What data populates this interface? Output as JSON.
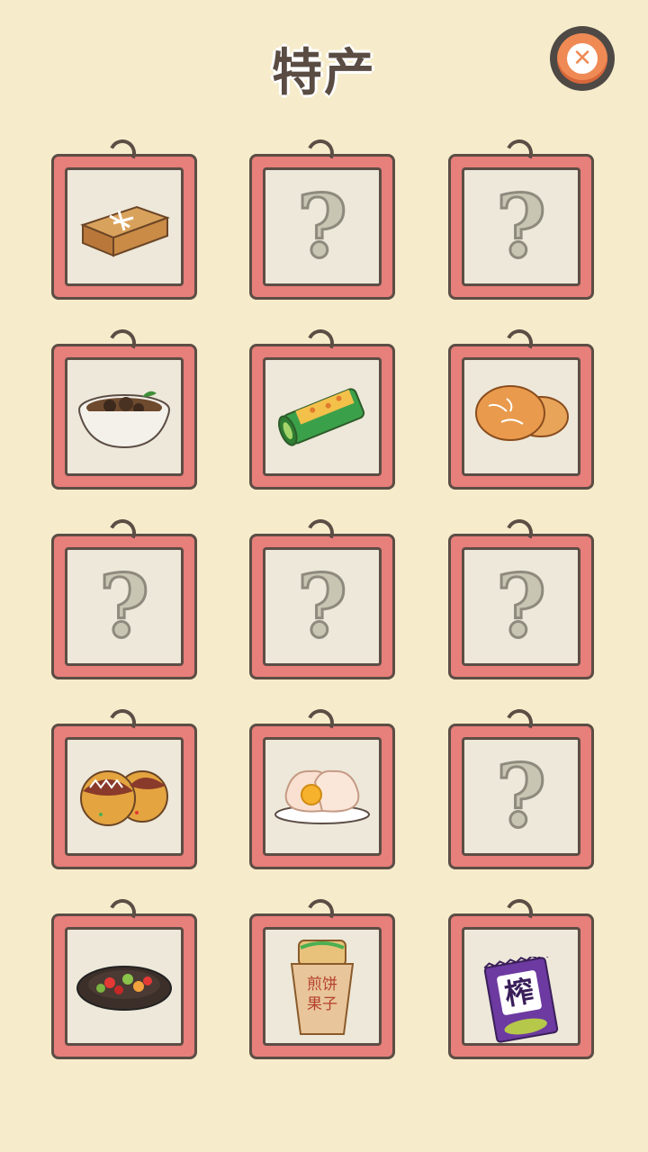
{
  "header": {
    "title": "特产",
    "close_icon": "close-x-icon"
  },
  "colors": {
    "background": "#f6eccb",
    "frame": "#e77f7a",
    "paper": "#ede8d9",
    "outline": "#5c4d45",
    "close": "#ef8a55"
  },
  "grid": {
    "columns": 3,
    "items": [
      {
        "state": "cut-off"
      },
      {
        "state": "cut-off"
      },
      {
        "state": "cut-off"
      },
      {
        "state": "unlocked",
        "icon": "pastry-box-icon"
      },
      {
        "state": "locked",
        "icon": "question-mark-icon"
      },
      {
        "state": "locked",
        "icon": "question-mark-icon"
      },
      {
        "state": "unlocked",
        "icon": "bowl-stew-icon"
      },
      {
        "state": "unlocked",
        "icon": "bamboo-rice-icon"
      },
      {
        "state": "unlocked",
        "icon": "sesame-cake-icon"
      },
      {
        "state": "locked",
        "icon": "question-mark-icon"
      },
      {
        "state": "locked",
        "icon": "question-mark-icon"
      },
      {
        "state": "locked",
        "icon": "question-mark-icon"
      },
      {
        "state": "unlocked",
        "icon": "takoyaki-icon"
      },
      {
        "state": "unlocked",
        "icon": "steamed-bun-icon"
      },
      {
        "state": "locked",
        "icon": "question-mark-icon"
      },
      {
        "state": "unlocked",
        "icon": "stir-fry-plate-icon"
      },
      {
        "state": "unlocked",
        "icon": "jianbing-icon",
        "label_line1": "煎饼",
        "label_line2": "果子"
      },
      {
        "state": "unlocked",
        "icon": "zhacai-pack-icon",
        "label": "榨"
      }
    ]
  },
  "question_glyph": "?"
}
